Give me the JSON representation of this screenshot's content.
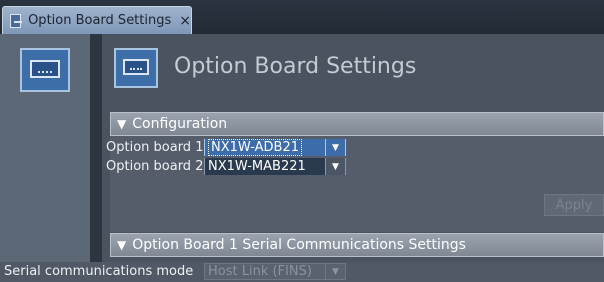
{
  "tab": {
    "label": "Option Board Settings",
    "close": "×"
  },
  "header": {
    "title": "Option Board Settings"
  },
  "configuration": {
    "title": "Configuration",
    "rows": [
      {
        "label": "Option board 1",
        "value": "NX1W-ADB21",
        "focused": true
      },
      {
        "label": "Option board 2",
        "value": "NX1W-MAB221",
        "focused": false
      }
    ],
    "apply_label": "Apply"
  },
  "serial_section": {
    "title": "Option Board 1 Serial Communications Settings",
    "mode_label": "Serial communications mode",
    "mode_value": "Host Link (FINS)"
  },
  "icons": {
    "expand": "▼",
    "dropdown": "▼"
  },
  "colors": {
    "accent": "#3d6cab",
    "panel": "#4a5360",
    "tab": "#8fa6c3"
  }
}
